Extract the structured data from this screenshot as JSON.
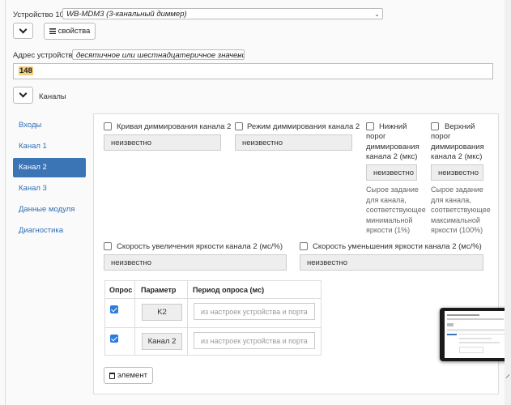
{
  "device": {
    "label": "Устройство 10",
    "type_value": "WB-MDM3 (3-канальный диммер)",
    "props_button": "свойства",
    "address_label": "Адрес устройства",
    "address_format": "десятичное или шестнадцатеричное значение",
    "address_value": "148"
  },
  "channels_section": {
    "title": "Каналы"
  },
  "nav": {
    "items": [
      {
        "label": "Входы"
      },
      {
        "label": "Канал 1"
      },
      {
        "label": "Канал 2"
      },
      {
        "label": "Канал 3"
      },
      {
        "label": "Данные модуля"
      },
      {
        "label": "Диагностика"
      }
    ],
    "active_index": 2
  },
  "fields": {
    "curve": {
      "label": "Кривая диммирования канала 2",
      "value": "неизвестно"
    },
    "mode": {
      "label": "Режим диммирования канала 2",
      "value": "неизвестно"
    },
    "low": {
      "label_lines": [
        "Нижний",
        "порог",
        "диммирования",
        "канала 2 (мкс)"
      ],
      "value": "неизвестно",
      "help_lines": [
        "Сырое задание",
        "для канала,",
        "соответствующее",
        "минимальной",
        "яркости (1%)"
      ]
    },
    "high": {
      "label_lines": [
        "Верхний",
        "порог",
        "диммирования",
        "канала 2 (мкс)"
      ],
      "value": "неизвестно",
      "help_lines": [
        "Сырое задание",
        "для канала,",
        "соответствующее",
        "максимальной",
        "яркости (100%)"
      ]
    },
    "rise": {
      "label": "Скорость увеличения яркости канала 2 (мс/%)",
      "value": "неизвестно"
    },
    "fall": {
      "label": "Скорость уменьшения яркости канала 2 (мс/%)",
      "value": "неизвестно"
    }
  },
  "poll_table": {
    "headers": [
      "Опрос",
      "Параметр",
      "Период опроса (мс)"
    ],
    "rows": [
      {
        "checked": true,
        "param": "K2",
        "placeholder": "из настроек устройства и порта"
      },
      {
        "checked": true,
        "param": "Канал 2",
        "placeholder": "из настроек устройства и порта"
      }
    ]
  },
  "add_button": {
    "label": "элемент"
  },
  "colors": {
    "accent": "#3b75b5",
    "link": "#2f6fb5",
    "highlight": "#f6d07a",
    "checkbox": "#2b7de1"
  }
}
